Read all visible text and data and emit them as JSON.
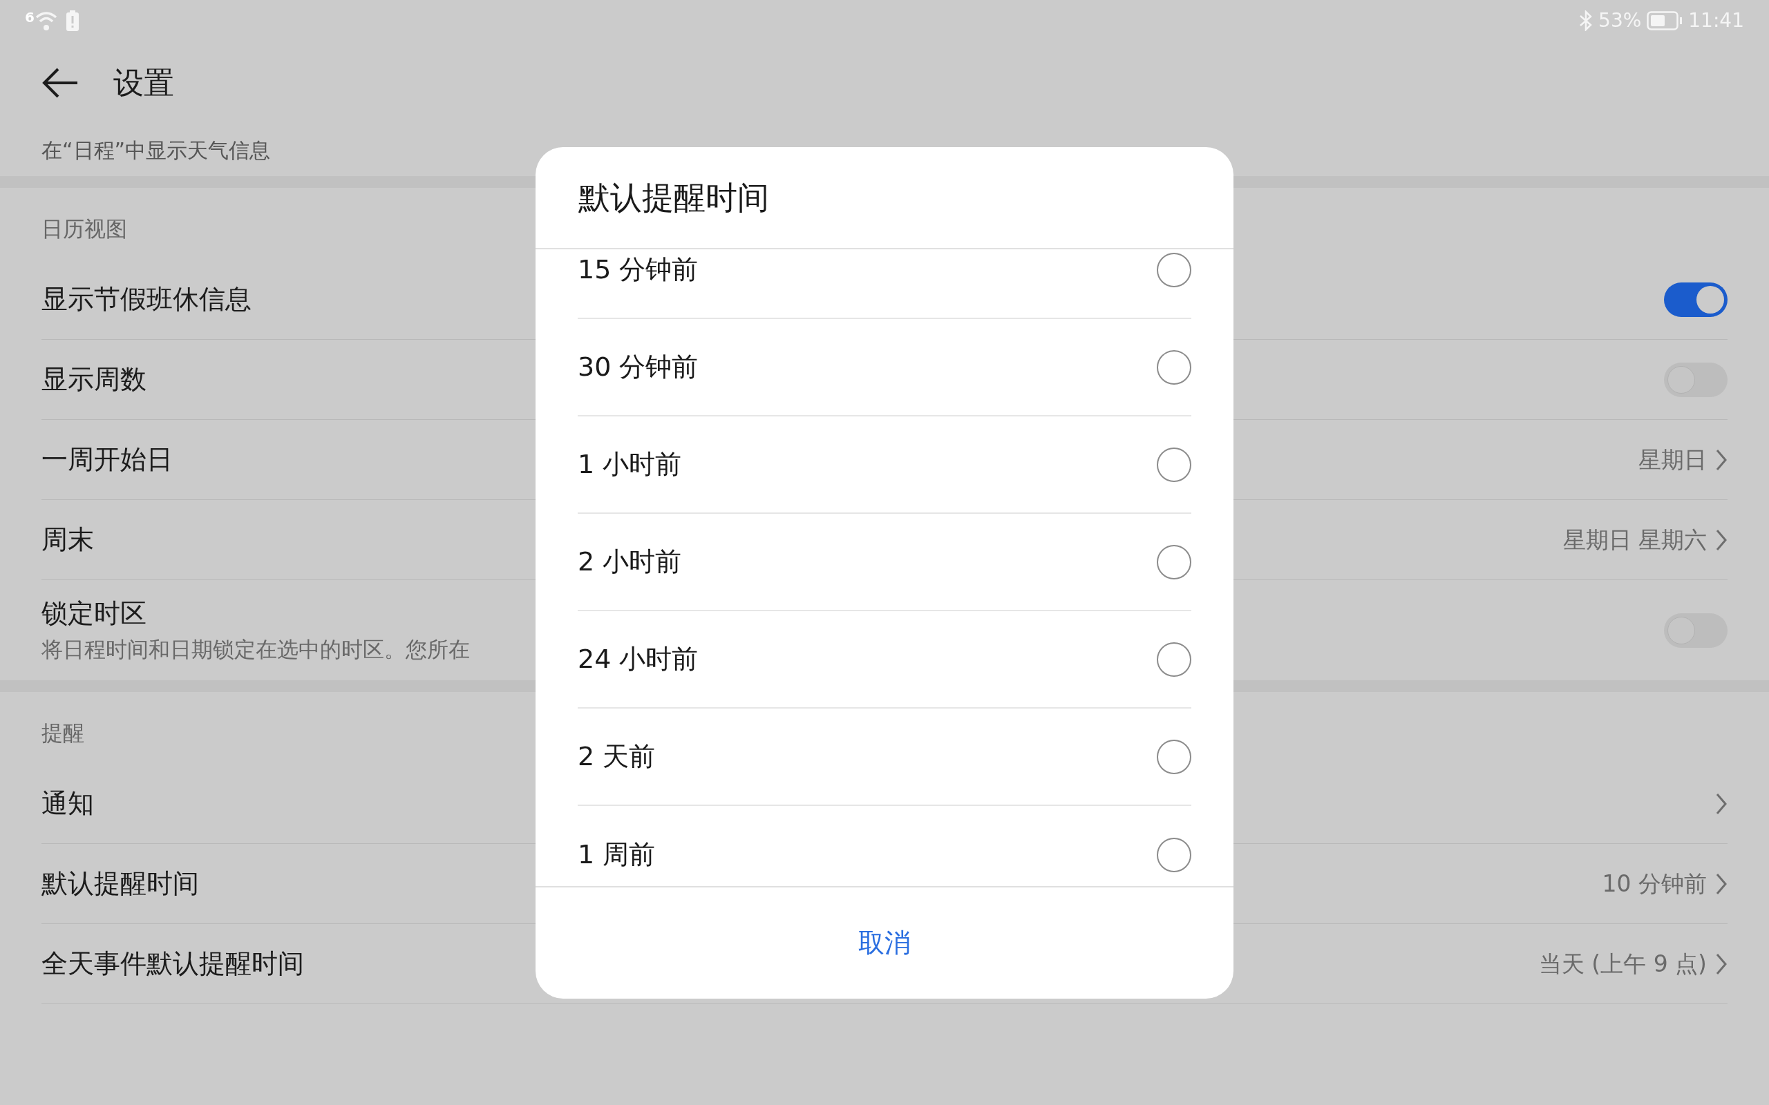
{
  "status_bar": {
    "wifi_label": "6",
    "battery_percent": "53%",
    "time": "11:41"
  },
  "header": {
    "title": "设置"
  },
  "partial_text": "在“日程”中显示天气信息",
  "sections": [
    {
      "title": "日历视图",
      "items": [
        {
          "kind": "toggle",
          "label": "显示节假班休信息",
          "on": true
        },
        {
          "kind": "toggle",
          "label": "显示周数",
          "on": false
        },
        {
          "kind": "link",
          "label": "一周开始日",
          "value": "星期日"
        },
        {
          "kind": "link",
          "label": "周末",
          "value": "星期日 星期六"
        },
        {
          "kind": "toggle",
          "label": "锁定时区",
          "description": "将日程时间和日期锁定在选中的时区。您所在",
          "on": false
        }
      ]
    },
    {
      "title": "提醒",
      "items": [
        {
          "kind": "link",
          "label": "通知"
        },
        {
          "kind": "link",
          "label": "默认提醒时间",
          "value": "10 分钟前"
        },
        {
          "kind": "link",
          "label": "全天事件默认提醒时间",
          "value": "当天 (上午 9 点)"
        }
      ]
    }
  ],
  "dialog": {
    "title": "默认提醒时间",
    "options": [
      {
        "label": "15 分钟前",
        "selected": false
      },
      {
        "label": "30 分钟前",
        "selected": false
      },
      {
        "label": "1 小时前",
        "selected": false
      },
      {
        "label": "2 小时前",
        "selected": false
      },
      {
        "label": "24 小时前",
        "selected": false
      },
      {
        "label": "2 天前",
        "selected": false
      },
      {
        "label": "1 周前",
        "selected": false
      }
    ],
    "cancel": "取消"
  }
}
